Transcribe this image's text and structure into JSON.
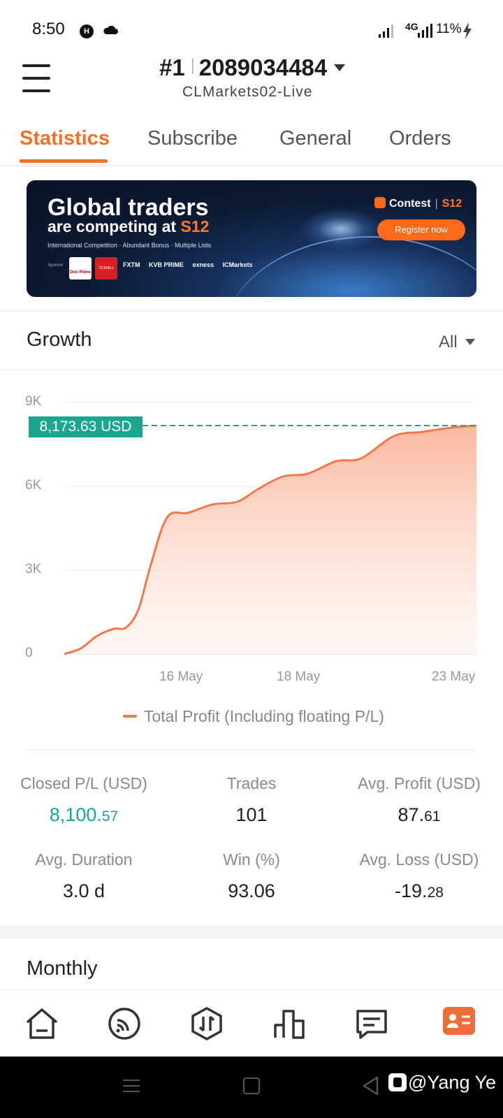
{
  "status_bar": {
    "time": "8:50",
    "network": "4G",
    "battery": "11%"
  },
  "header": {
    "account_rank": "#1",
    "account_number": "2089034484",
    "server": "CLMarkets02-Live"
  },
  "tabs": [
    {
      "label": "Statistics",
      "active": true
    },
    {
      "label": "Subscribe",
      "active": false
    },
    {
      "label": "General",
      "active": false
    },
    {
      "label": "Orders",
      "active": false
    }
  ],
  "banner": {
    "headline_1": "Global traders",
    "headline_2_prefix": "are competing at ",
    "headline_2_highlight": "S12",
    "subline": "International Competition · Abundant Bonus · Multiple Lists",
    "sponsor_label": "Sponsor",
    "sponsor_logo_1": "Doo Prime",
    "sponsor_logo_2": "TICKMILL",
    "sponsors": [
      "FXTM",
      "KVB PRIME",
      "exness",
      "ICMarkets"
    ],
    "contest_label": "Contest",
    "contest_season": "S12",
    "cta_label": "Register now"
  },
  "growth": {
    "title": "Growth",
    "range_label": "All",
    "current_value_label": "8,173.63 USD",
    "legend_label": "Total Profit (Including floating P/L)"
  },
  "chart_data": {
    "type": "area",
    "title": "Growth",
    "y_ticks": [
      "9K",
      "6K",
      "3K",
      "0"
    ],
    "x_ticks": [
      "16 May",
      "18 May",
      "23 May"
    ],
    "ylim": [
      0,
      9000
    ],
    "grid": true,
    "legend_position": "bottom",
    "series": [
      {
        "name": "Total Profit (Including floating P/L)",
        "color": "#f07a4a",
        "points": [
          {
            "x": 0.0,
            "y": 0
          },
          {
            "x": 0.04,
            "y": 200
          },
          {
            "x": 0.08,
            "y": 650
          },
          {
            "x": 0.12,
            "y": 900
          },
          {
            "x": 0.15,
            "y": 950
          },
          {
            "x": 0.18,
            "y": 1600
          },
          {
            "x": 0.21,
            "y": 3200
          },
          {
            "x": 0.25,
            "y": 4900
          },
          {
            "x": 0.3,
            "y": 5050
          },
          {
            "x": 0.36,
            "y": 5350
          },
          {
            "x": 0.42,
            "y": 5450
          },
          {
            "x": 0.47,
            "y": 5900
          },
          {
            "x": 0.53,
            "y": 6350
          },
          {
            "x": 0.59,
            "y": 6450
          },
          {
            "x": 0.66,
            "y": 6900
          },
          {
            "x": 0.72,
            "y": 7000
          },
          {
            "x": 0.8,
            "y": 7800
          },
          {
            "x": 0.87,
            "y": 7950
          },
          {
            "x": 0.94,
            "y": 8100
          },
          {
            "x": 1.0,
            "y": 8173.63
          }
        ]
      }
    ],
    "current_value": 8173.63,
    "colors": {
      "line": "#f07a4a",
      "fill_top": "#fbb49a",
      "marker": "#1aa68f"
    }
  },
  "stats": [
    {
      "label": "Closed P/L (USD)",
      "int": "8,100.",
      "dec": "57",
      "accent": true
    },
    {
      "label": "Trades",
      "int": "101",
      "dec": "",
      "accent": false
    },
    {
      "label": "Avg. Profit (USD)",
      "int": "87.",
      "dec": "61",
      "accent": false
    },
    {
      "label": "Avg. Duration",
      "int": "3.0 d",
      "dec": "",
      "accent": false
    },
    {
      "label": "Win (%)",
      "int": "93.06",
      "dec": "",
      "accent": false
    },
    {
      "label": "Avg. Loss (USD)",
      "int": "-19.",
      "dec": "28",
      "accent": false
    }
  ],
  "monthly": {
    "title": "Monthly"
  },
  "bottom_nav": [
    {
      "icon": "home-icon",
      "active": false
    },
    {
      "icon": "feed-icon",
      "active": false
    },
    {
      "icon": "trade-icon",
      "active": false
    },
    {
      "icon": "market-chart-icon",
      "active": false
    },
    {
      "icon": "messages-icon",
      "active": false
    },
    {
      "icon": "profile-card-icon",
      "active": true
    }
  ],
  "watermark": "@Yang Ye",
  "colors": {
    "accent": "#f07128",
    "positive": "#1aa68f"
  }
}
